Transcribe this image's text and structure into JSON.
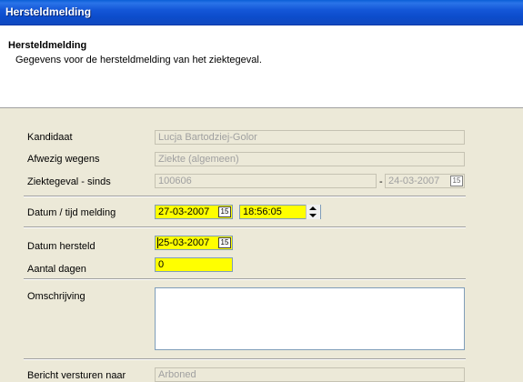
{
  "window": {
    "title": "Hersteldmelding"
  },
  "header": {
    "title": "Hersteldmelding",
    "subtitle": "Gegevens voor de hersteldmelding van het ziektegeval."
  },
  "form": {
    "kandidaat": {
      "label": "Kandidaat",
      "value": "Lucja Bartodziej-Golor"
    },
    "afwezig": {
      "label": "Afwezig wegens",
      "value": "Ziekte (algemeen)"
    },
    "ziektegeval": {
      "label": "Ziektegeval - sinds",
      "value": "100606",
      "separator": "-",
      "date": "24-03-2007"
    },
    "melding": {
      "label": "Datum / tijd melding",
      "date": "27-03-2007",
      "time": "18:56:05"
    },
    "hersteld": {
      "label": "Datum hersteld",
      "date": "25-03-2007"
    },
    "dagen": {
      "label": "Aantal dagen",
      "value": "0"
    },
    "omschrijving": {
      "label": "Omschrijving",
      "value": ""
    },
    "bericht": {
      "label": "Bericht versturen naar",
      "value": "Arboned"
    },
    "calendar_glyph": "15"
  },
  "colors": {
    "highlight": "#FFFF00",
    "titlebar": "#0C4CCB",
    "background": "#ECE9D8"
  }
}
